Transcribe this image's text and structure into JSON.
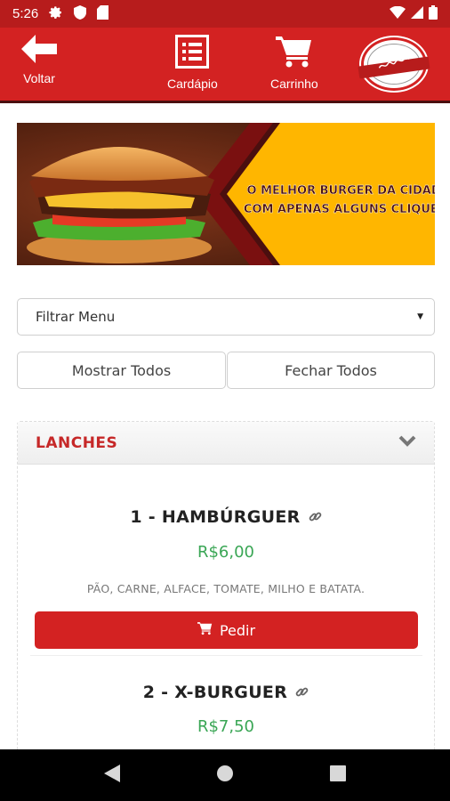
{
  "status_bar": {
    "time": "5:26",
    "icons": [
      "gear-icon",
      "shield-icon",
      "sd-card-icon",
      "wifi-icon",
      "signal-icon",
      "battery-icon"
    ]
  },
  "app_bar": {
    "back_label": "Voltar",
    "menu_label": "Cardápio",
    "cart_label": "Carrinho",
    "background": "#d32222"
  },
  "banner": {
    "headline_line1": "O MELHOR BURGER DA CIDADE",
    "headline_line2": "COM APENAS ALGUNS CLIQUES!",
    "accent": "#ffb600"
  },
  "filter": {
    "selected": "Filtrar Menu"
  },
  "actions": {
    "show_all": "Mostrar Todos",
    "close_all": "Fechar Todos"
  },
  "category": {
    "title": "LANCHES",
    "items": [
      {
        "name": "1 - HAMBÚRGUER",
        "price": "R$6,00",
        "description": "PÃO, CARNE, ALFACE, TOMATE, MILHO E BATATA.",
        "order_label": "Pedir"
      },
      {
        "name": "2 - X-BURGUER",
        "price": "R$7,50"
      }
    ]
  },
  "colors": {
    "brand_red": "#d32222",
    "price_green": "#3aa655",
    "title_red": "#c62828"
  }
}
